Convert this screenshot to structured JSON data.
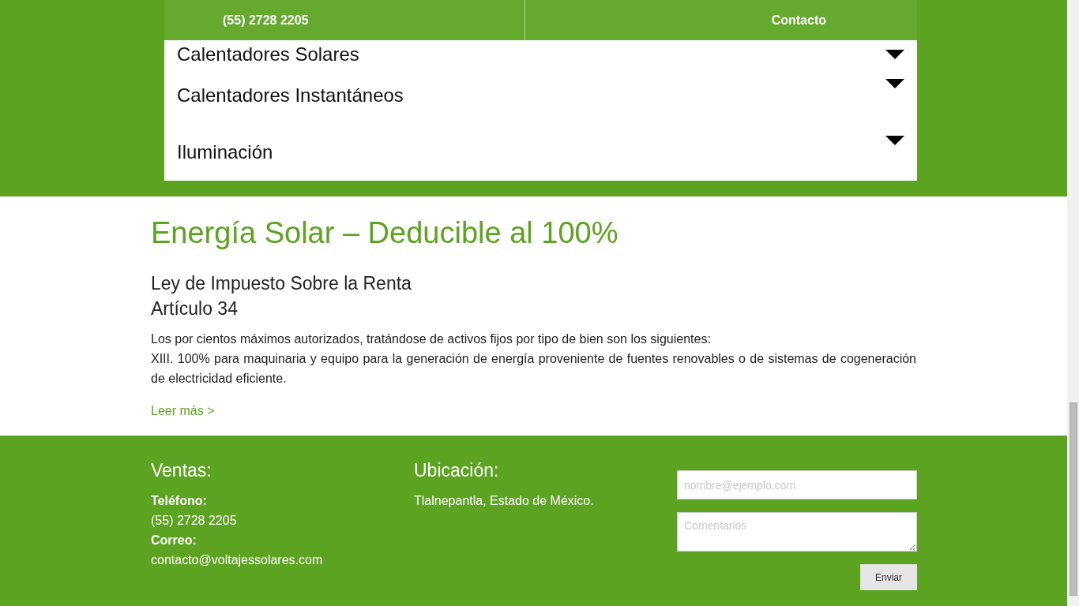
{
  "header": {
    "phone": "(55) 2728 2205",
    "contact": "Contacto"
  },
  "accordion": [
    {
      "label": "Calentadores Solares"
    },
    {
      "label": "Calentadores Instantáneos"
    },
    {
      "label": "Iluminación"
    }
  ],
  "article": {
    "title": "Energía Solar – Deducible al 100%",
    "subtitle_lines": [
      "Ley de Impuesto Sobre la Renta",
      "Artículo 34"
    ],
    "paragraphs": [
      "Los por cientos máximos autorizados, tratándose de activos fijos por tipo de bien son los siguientes:",
      "XIII. 100% para maquinaria y equipo para la generación de energía proveniente de fuentes renovables o de sistemas de cogeneración de electricidad eficiente."
    ],
    "link": "Leer más >"
  },
  "footer": {
    "sales": {
      "heading": "Ventas:",
      "lines": [
        {
          "kind": "label",
          "text": "Teléfono:"
        },
        {
          "kind": "value",
          "text": "(55) 2728 2205"
        },
        {
          "kind": "label",
          "text": "Correo:"
        },
        {
          "kind": "value",
          "text": "contacto@voltajessolares.com"
        }
      ]
    },
    "location": {
      "heading": "Ubicación:",
      "text": "Tlalnepantla, Estado de México."
    },
    "form": {
      "email": {
        "placeholder": "nombre@ejemplo.com"
      },
      "comments": {
        "placeholder": "Comentarios"
      },
      "submit": "Enviar"
    }
  }
}
